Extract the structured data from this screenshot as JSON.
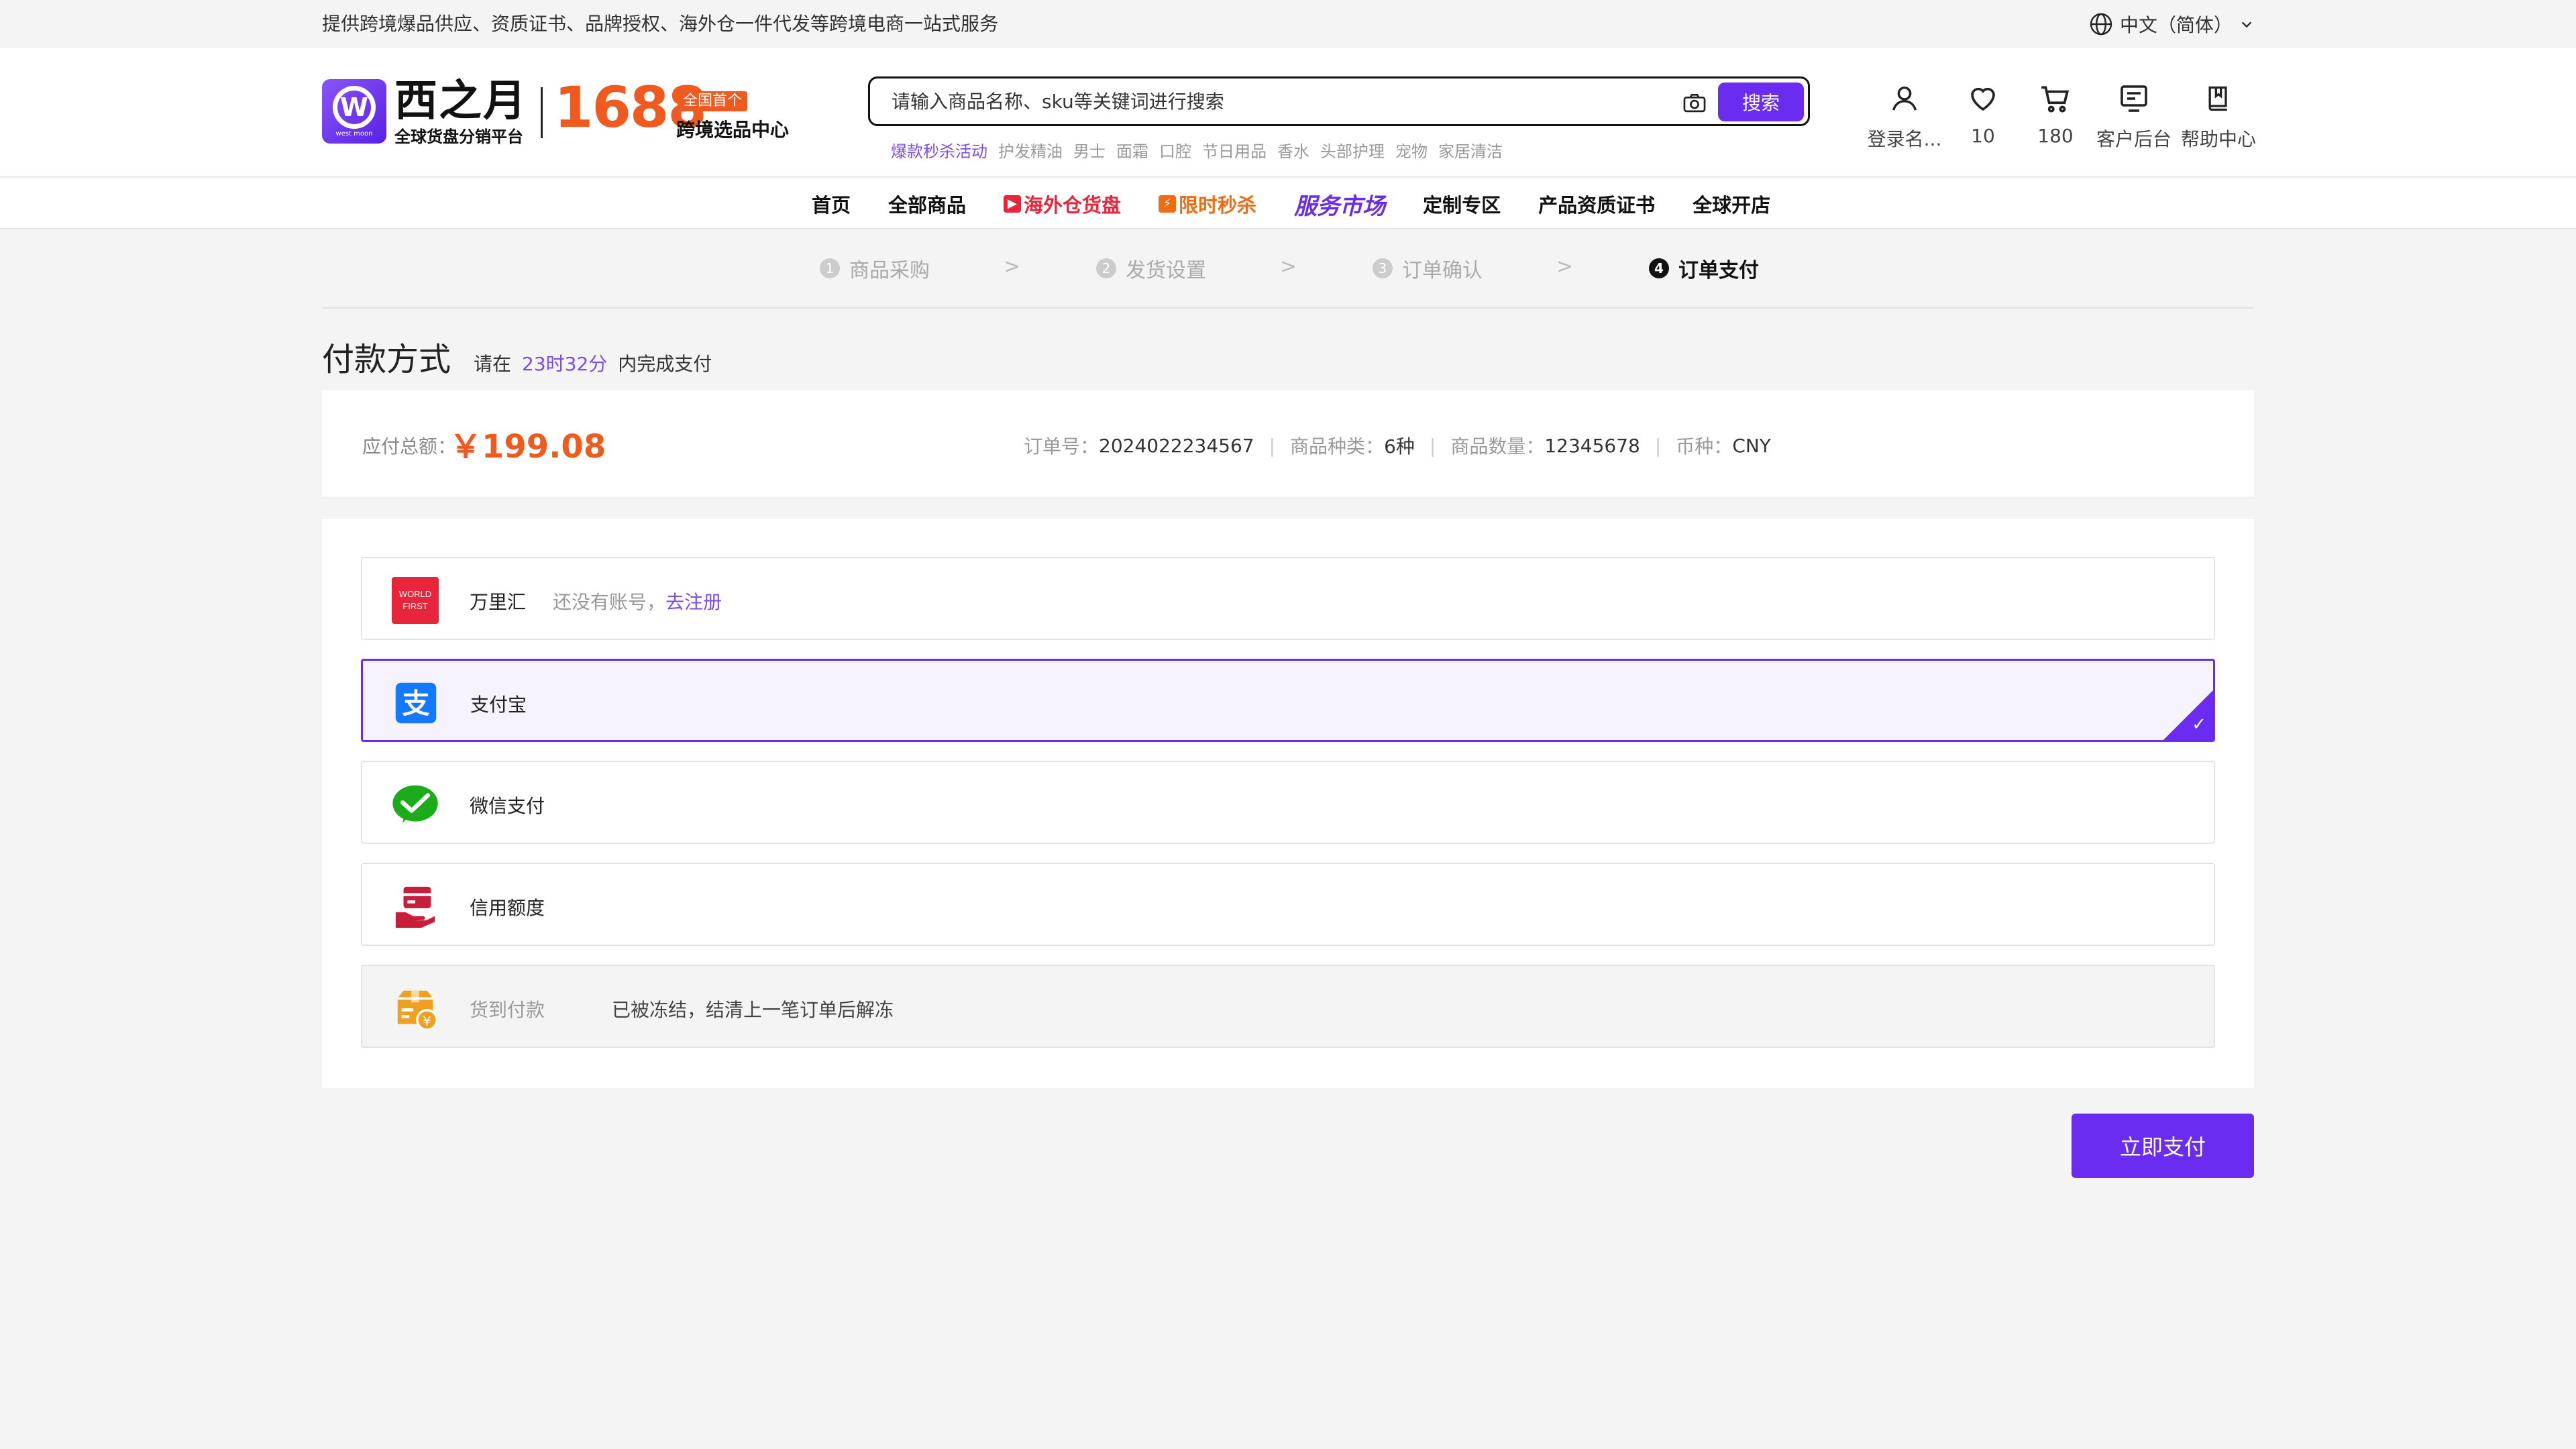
{
  "topbar": {
    "slogan": "提供跨境爆品供应、资质证书、品牌授权、海外仓一件代发等跨境电商一站式服务",
    "language": "中文（简体）"
  },
  "header": {
    "brand_name": "西之月",
    "brand_sub": "全球货盘分销平台",
    "brand_logo_small": "west moon",
    "brand_1688": "1688",
    "brand_tag": "全国首个",
    "brand_center": "跨境选品中心",
    "search_placeholder": "请输入商品名称、sku等关键词进行搜索",
    "search_button": "搜索",
    "hotwords": [
      "爆款秒杀活动",
      "护发精油",
      "男士",
      "面霜",
      "口腔",
      "节日用品",
      "香水",
      "头部护理",
      "宠物",
      "家居清洁"
    ],
    "icons": [
      {
        "icon": "user-icon",
        "label": "登录名..."
      },
      {
        "icon": "heart-icon",
        "label": "10"
      },
      {
        "icon": "cart-icon",
        "label": "180"
      },
      {
        "icon": "admin-icon",
        "label": "客户后台"
      },
      {
        "icon": "book-icon",
        "label": "帮助中心"
      }
    ]
  },
  "nav": {
    "items": [
      "首页",
      "全部商品",
      "海外仓货盘",
      "限时秒杀",
      "服务市场",
      "定制专区",
      "产品资质证书",
      "全球开店"
    ]
  },
  "steps": [
    {
      "num": "1",
      "label": "商品采购"
    },
    {
      "num": "2",
      "label": "发货设置"
    },
    {
      "num": "3",
      "label": "订单确认"
    },
    {
      "num": "4",
      "label": "订单支付"
    }
  ],
  "payment": {
    "title": "付款方式",
    "tip_prefix": "请在",
    "time_left": "23时32分",
    "tip_suffix": "内完成支付"
  },
  "summary": {
    "total_label": "应付总额：",
    "total_amount": "￥199.08",
    "order_no_label": "订单号：",
    "order_no": "2024022234567",
    "kinds_label": "商品种类：",
    "kinds": "6种",
    "qty_label": "商品数量：",
    "qty": "12345678",
    "currency_label": "币种：",
    "currency": "CNY"
  },
  "methods": [
    {
      "name": "万里汇",
      "extra": "还没有账号，",
      "link": "去注册",
      "icon": "worldfirst-icon",
      "icon_text": "WORLD FIRST",
      "color": "#e8253a"
    },
    {
      "name": "支付宝",
      "icon": "alipay-icon",
      "color": "#1677ff",
      "selected": true
    },
    {
      "name": "微信支付",
      "icon": "wechat-pay-icon",
      "color": "#1aad19"
    },
    {
      "name": "信用额度",
      "icon": "credit-icon",
      "color": "#c81e3c"
    },
    {
      "name": "货到付款",
      "extra": "已被冻结，结清上一笔订单后解冻",
      "icon": "cod-icon",
      "color": "#f0a020",
      "disabled": true
    }
  ],
  "pay_button": "立即支付",
  "colors": {
    "accent": "#6a2cf0",
    "price": "#f15a1e"
  }
}
